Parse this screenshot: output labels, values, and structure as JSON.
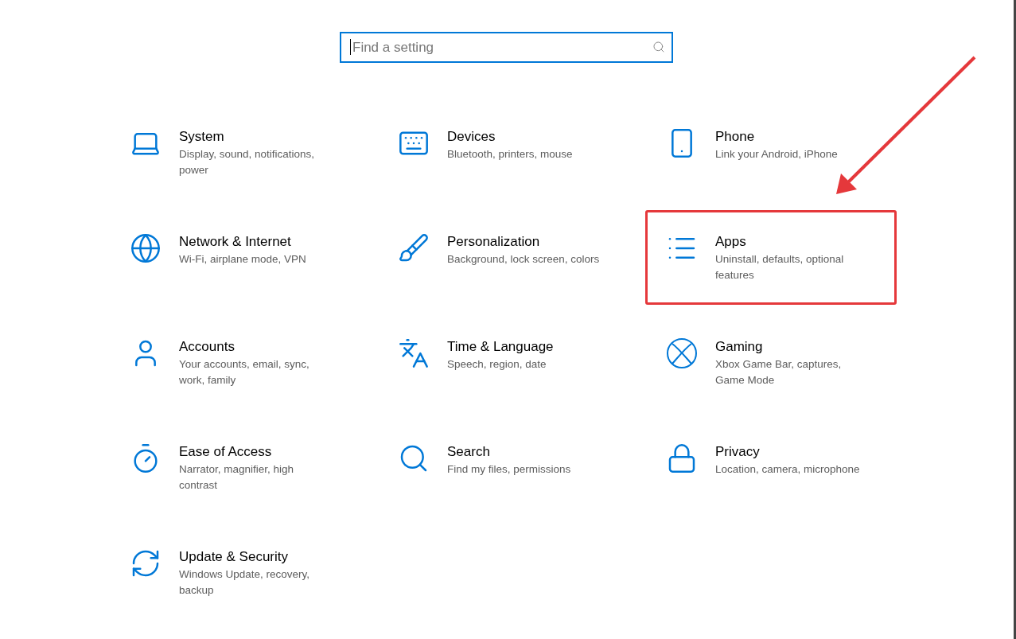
{
  "search": {
    "placeholder": "Find a setting"
  },
  "categories": [
    {
      "title": "System",
      "description": "Display, sound, notifications, power",
      "highlighted": false
    },
    {
      "title": "Devices",
      "description": "Bluetooth, printers, mouse",
      "highlighted": false
    },
    {
      "title": "Phone",
      "description": "Link your Android, iPhone",
      "highlighted": false
    },
    {
      "title": "Network & Internet",
      "description": "Wi-Fi, airplane mode, VPN",
      "highlighted": false
    },
    {
      "title": "Personalization",
      "description": "Background, lock screen, colors",
      "highlighted": false
    },
    {
      "title": "Apps",
      "description": "Uninstall, defaults, optional features",
      "highlighted": true
    },
    {
      "title": "Accounts",
      "description": "Your accounts, email, sync, work, family",
      "highlighted": false
    },
    {
      "title": "Time & Language",
      "description": "Speech, region, date",
      "highlighted": false
    },
    {
      "title": "Gaming",
      "description": "Xbox Game Bar, captures, Game Mode",
      "highlighted": false
    },
    {
      "title": "Ease of Access",
      "description": "Narrator, magnifier, high contrast",
      "highlighted": false
    },
    {
      "title": "Search",
      "description": "Find my files, permissions",
      "highlighted": false
    },
    {
      "title": "Privacy",
      "description": "Location, camera, microphone",
      "highlighted": false
    },
    {
      "title": "Update & Security",
      "description": "Windows Update, recovery, backup",
      "highlighted": false
    }
  ]
}
